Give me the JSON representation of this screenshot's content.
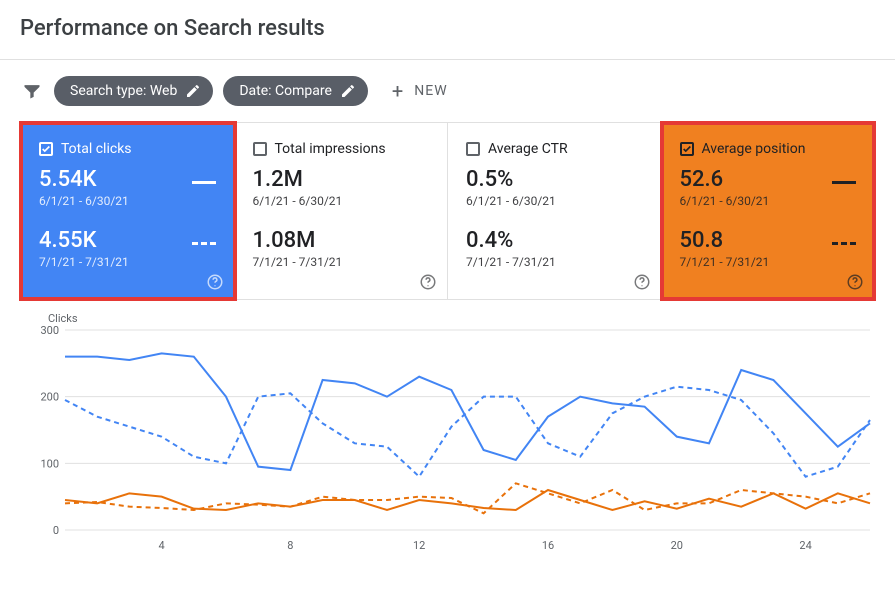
{
  "header": {
    "title": "Performance on Search results"
  },
  "filters": {
    "search_type_chip": "Search type: Web",
    "date_chip": "Date: Compare",
    "new_label": "NEW"
  },
  "cards": [
    {
      "id": "total-clicks",
      "label": "Total clicks",
      "selected": true,
      "highlight": true,
      "theme": "blue",
      "period_a": {
        "value": "5.54K",
        "range": "6/1/21 - 6/30/21",
        "line": "solid"
      },
      "period_b": {
        "value": "4.55K",
        "range": "7/1/21 - 7/31/21",
        "line": "dashed"
      }
    },
    {
      "id": "total-impressions",
      "label": "Total impressions",
      "selected": false,
      "highlight": false,
      "theme": "plain",
      "period_a": {
        "value": "1.2M",
        "range": "6/1/21 - 6/30/21"
      },
      "period_b": {
        "value": "1.08M",
        "range": "7/1/21 - 7/31/21"
      }
    },
    {
      "id": "average-ctr",
      "label": "Average CTR",
      "selected": false,
      "highlight": false,
      "theme": "plain",
      "period_a": {
        "value": "0.5%",
        "range": "6/1/21 - 6/30/21"
      },
      "period_b": {
        "value": "0.4%",
        "range": "7/1/21 - 7/31/21"
      }
    },
    {
      "id": "average-position",
      "label": "Average position",
      "selected": true,
      "highlight": true,
      "theme": "orange",
      "period_a": {
        "value": "52.6",
        "range": "6/1/21 - 6/30/21",
        "line": "solid"
      },
      "period_b": {
        "value": "50.8",
        "range": "7/1/21 - 7/31/21",
        "line": "dashed"
      }
    }
  ],
  "chart_data": {
    "type": "line",
    "title": "",
    "ylabel": "Clicks",
    "xlabel": "",
    "ylim": [
      0,
      300
    ],
    "y_ticks": [
      0,
      100,
      200,
      300
    ],
    "x_ticks": [
      4,
      8,
      12,
      16,
      20,
      24
    ],
    "x": [
      1,
      2,
      3,
      4,
      5,
      6,
      7,
      8,
      9,
      10,
      11,
      12,
      13,
      14,
      15,
      16,
      17,
      18,
      19,
      20,
      21,
      22,
      23,
      24,
      25,
      26
    ],
    "series": [
      {
        "name": "Total clicks 6/1/21 - 6/30/21",
        "style": "solid",
        "color": "#4285f4",
        "values": [
          260,
          260,
          255,
          265,
          260,
          200,
          95,
          90,
          225,
          220,
          200,
          230,
          210,
          120,
          105,
          170,
          200,
          190,
          185,
          140,
          130,
          240,
          225,
          175,
          125,
          160
        ]
      },
      {
        "name": "Total clicks 7/1/21 - 7/31/21",
        "style": "dashed",
        "color": "#4285f4",
        "values": [
          195,
          170,
          155,
          140,
          110,
          100,
          200,
          205,
          160,
          130,
          125,
          80,
          155,
          200,
          200,
          130,
          110,
          175,
          200,
          215,
          210,
          195,
          145,
          80,
          95,
          165
        ]
      },
      {
        "name": "Average position 6/1/21 - 6/30/21",
        "style": "solid",
        "color": "#e8710a",
        "values": [
          45,
          40,
          55,
          50,
          32,
          30,
          40,
          35,
          45,
          45,
          30,
          45,
          40,
          33,
          30,
          60,
          45,
          30,
          43,
          32,
          47,
          35,
          55,
          32,
          55,
          40
        ]
      },
      {
        "name": "Average position 7/1/21 - 7/31/21",
        "style": "dashed",
        "color": "#e8710a",
        "values": [
          40,
          42,
          35,
          33,
          30,
          40,
          38,
          35,
          50,
          45,
          45,
          50,
          48,
          25,
          70,
          55,
          40,
          60,
          30,
          40,
          40,
          60,
          55,
          50,
          40,
          55
        ]
      }
    ]
  }
}
